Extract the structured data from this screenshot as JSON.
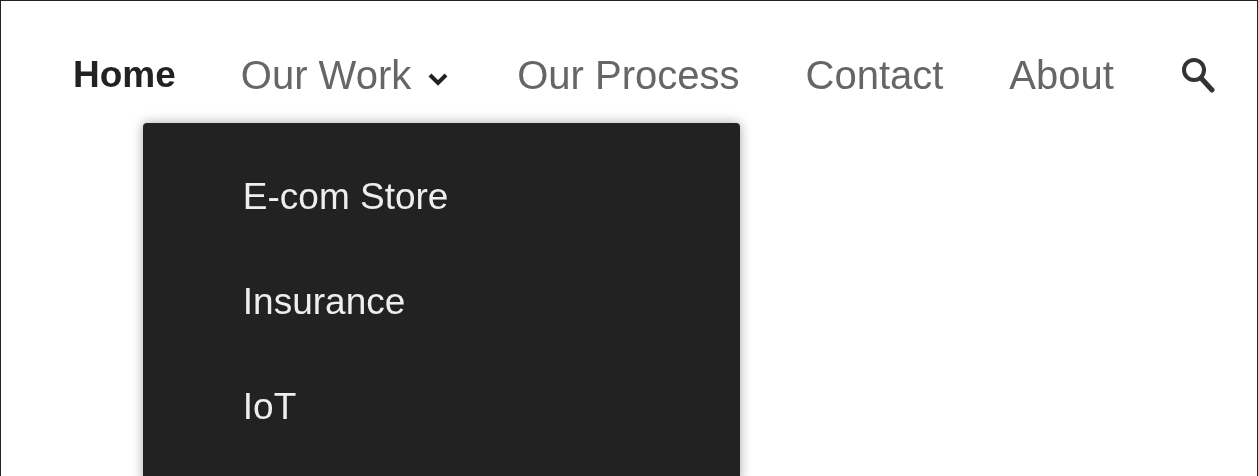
{
  "nav": {
    "items": [
      {
        "label": "Home",
        "kind": "link",
        "selected": true
      },
      {
        "label": "Our Work",
        "kind": "dropdown",
        "selected": false,
        "expanded": true,
        "children": [
          {
            "label": "E-com Store"
          },
          {
            "label": "Insurance"
          },
          {
            "label": "IoT"
          }
        ]
      },
      {
        "label": "Our Process",
        "kind": "link",
        "selected": false
      },
      {
        "label": "Contact",
        "kind": "link",
        "selected": false
      },
      {
        "label": "About",
        "kind": "link",
        "selected": false
      }
    ]
  }
}
